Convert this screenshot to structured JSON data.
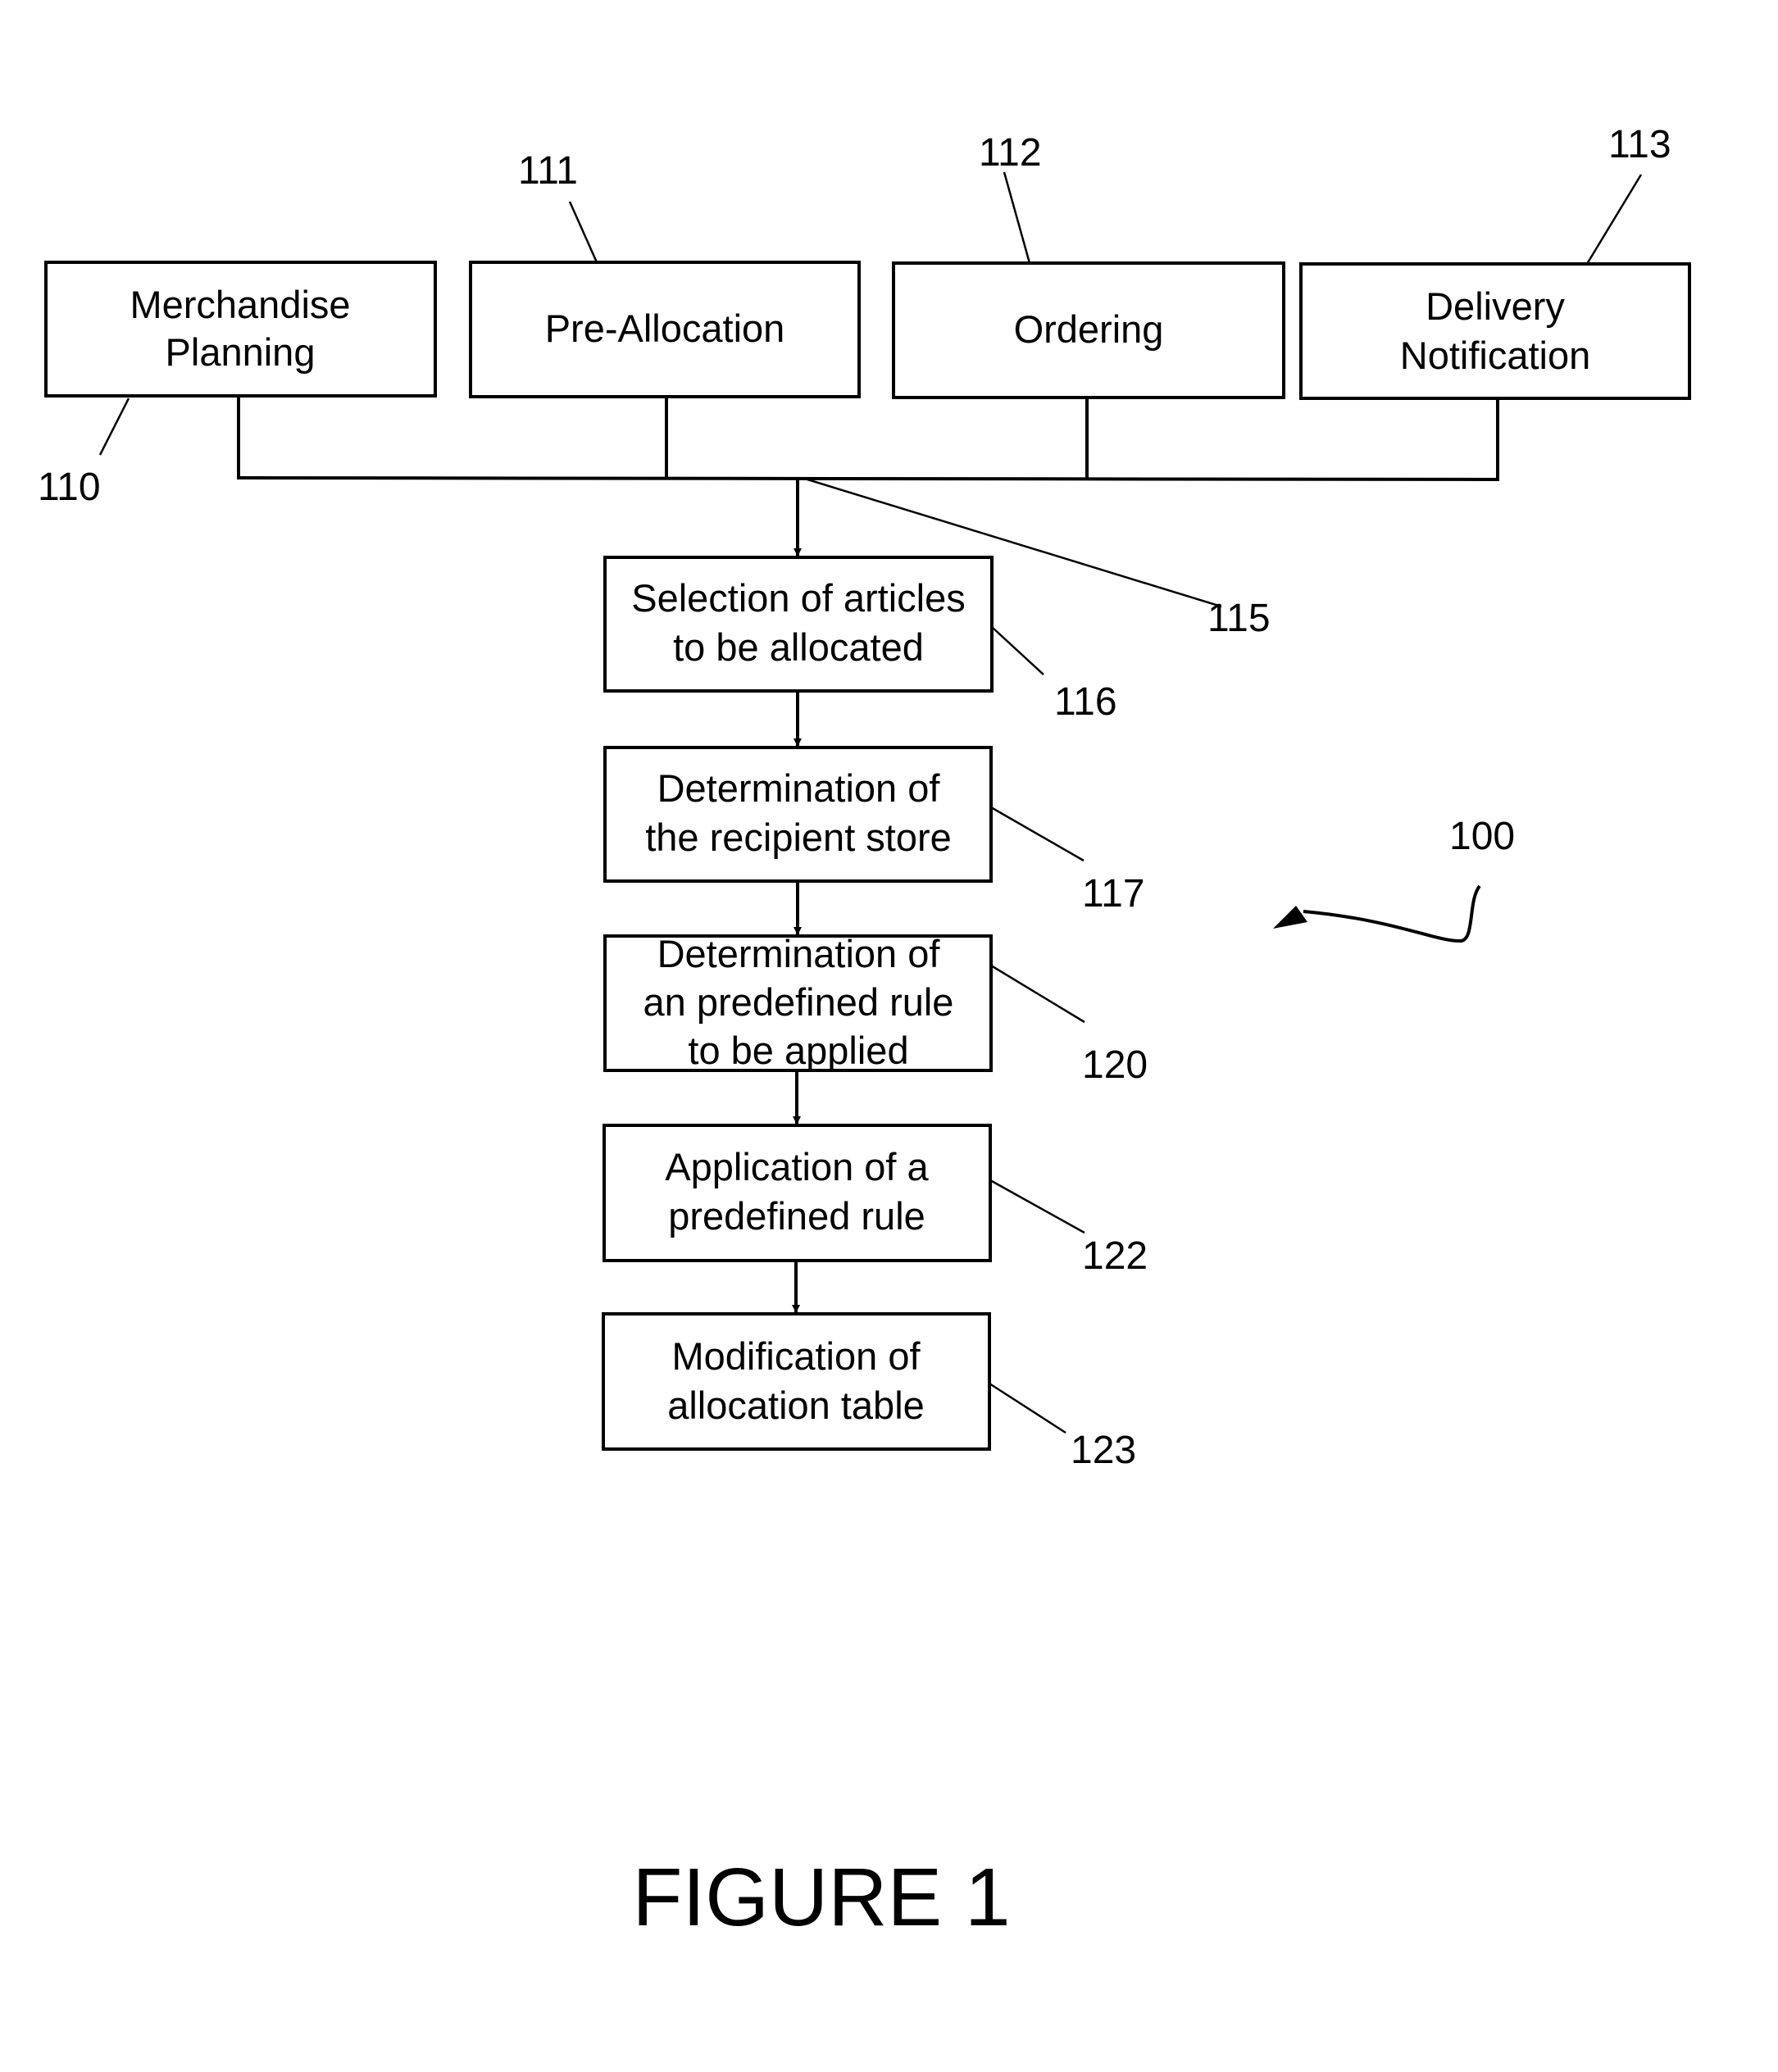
{
  "figure": {
    "caption": "FIGURE 1",
    "overall_ref": "100",
    "bus_ref": "115"
  },
  "top_boxes": [
    {
      "ref": "110",
      "lines": [
        "Merchandise",
        "Planning"
      ]
    },
    {
      "ref": "111",
      "lines": [
        "Pre-Allocation"
      ]
    },
    {
      "ref": "112",
      "lines": [
        "Ordering"
      ]
    },
    {
      "ref": "113",
      "lines": [
        "Delivery",
        "Notification"
      ]
    }
  ],
  "flow_steps": [
    {
      "ref": "116",
      "lines": [
        "Selection of articles",
        "to be allocated"
      ]
    },
    {
      "ref": "117",
      "lines": [
        "Determination of",
        "the recipient store"
      ]
    },
    {
      "ref": "120",
      "lines": [
        "Determination of",
        "an predefined rule",
        "to be applied"
      ]
    },
    {
      "ref": "122",
      "lines": [
        "Application of a",
        "predefined rule"
      ]
    },
    {
      "ref": "123",
      "lines": [
        "Modification of",
        "allocation table"
      ]
    }
  ]
}
